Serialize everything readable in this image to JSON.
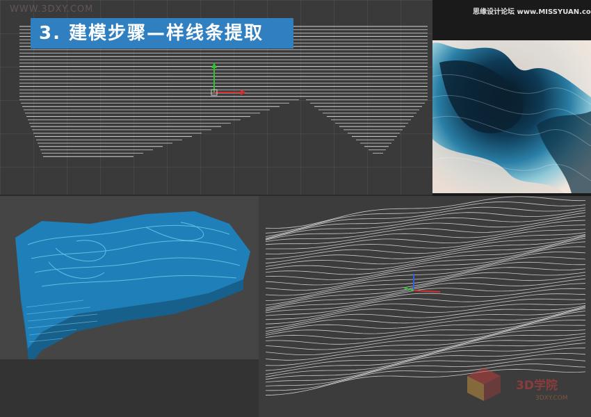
{
  "title_banner": {
    "text": "3. 建模步骤—样线条提取",
    "color": "#2f7fc1"
  },
  "watermarks": {
    "top_left": "WWW.3DXY.COM",
    "top_right": "思缘设计论坛 www.MISSYUAN.com",
    "bottom_right": "3D学院",
    "bottom_right_sub": "3DXY.COM"
  },
  "icons": {
    "gizmo": "transform-gizmo-icon",
    "logo": "3d-academy-logo-icon"
  },
  "colors": {
    "viewport_bg": "#3a3a3a",
    "lines": "#e6e6e6",
    "terrain_blue": "#1f8fc8",
    "gizmo_x": "#d03030",
    "gizmo_y": "#30c030",
    "gizmo_z": "#3060e0"
  }
}
